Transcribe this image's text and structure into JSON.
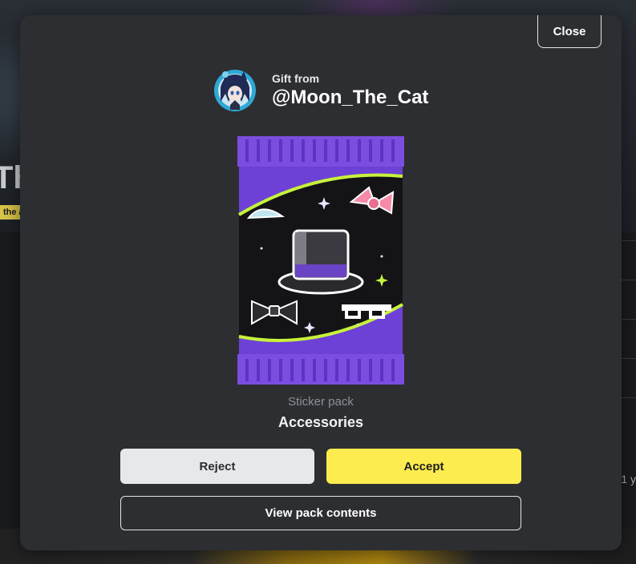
{
  "background": {
    "title_fragment": "Th",
    "tag_fragment": "the /",
    "side_text_fragment": "1 y"
  },
  "modal": {
    "close_label": "Close",
    "gift_from_label": "Gift from",
    "sender_name": "@Moon_The_Cat",
    "pack_type": "Sticker pack",
    "pack_name": "Accessories",
    "reject_label": "Reject",
    "accept_label": "Accept",
    "view_contents_label": "View pack contents"
  },
  "colors": {
    "modal_bg": "#2d2e31",
    "accept": "#fcec4f",
    "reject": "#e7e8ea",
    "pack_purple": "#7b4ee0",
    "pack_accent": "#c7f23a"
  }
}
